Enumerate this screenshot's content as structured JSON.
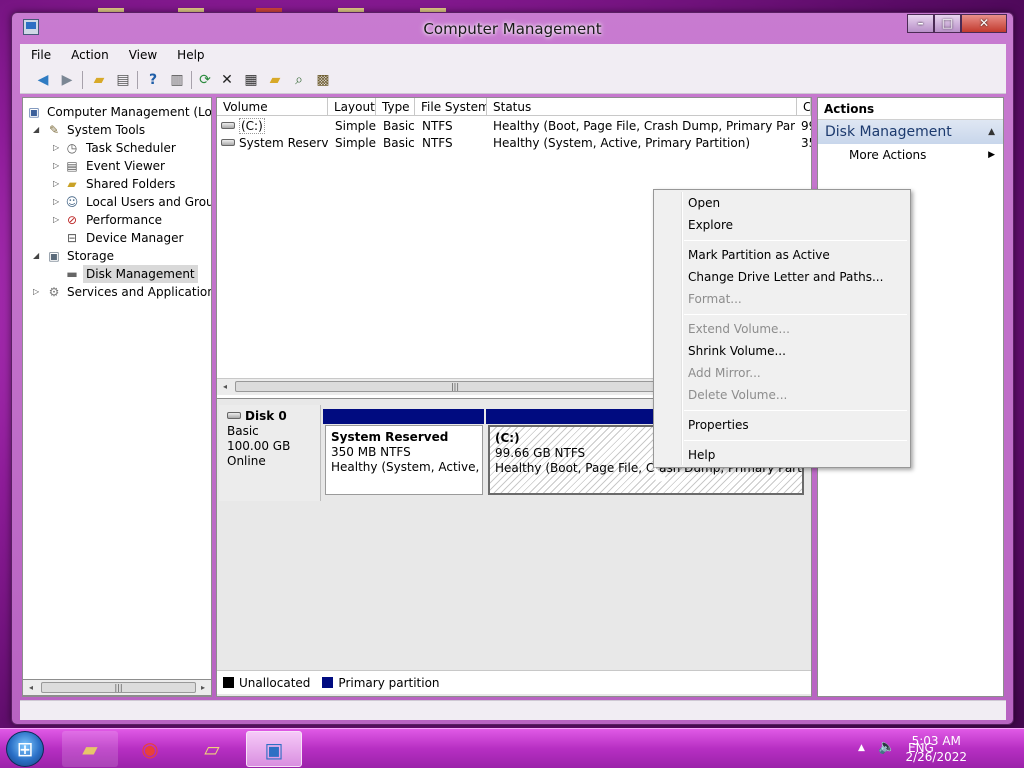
{
  "window": {
    "title": "Computer Management"
  },
  "menu": [
    "File",
    "Action",
    "View",
    "Help"
  ],
  "toolbar_icons": [
    "back-icon",
    "forward-icon",
    "up-folder-icon",
    "show-hide-tree-icon",
    "help-icon",
    "show-hide-action-pane-icon",
    "refresh-icon",
    "delete-icon",
    "properties-icon",
    "open-folder-icon",
    "search-icon",
    "connect-icon"
  ],
  "tree": [
    {
      "label": "Computer Management (Local",
      "depth": 0,
      "expander": "",
      "icon": "computer-icon"
    },
    {
      "label": "System Tools",
      "depth": 1,
      "expander": "open",
      "icon": "tools-icon"
    },
    {
      "label": "Task Scheduler",
      "depth": 2,
      "expander": "closed",
      "icon": "clock-icon"
    },
    {
      "label": "Event Viewer",
      "depth": 2,
      "expander": "closed",
      "icon": "event-viewer-icon"
    },
    {
      "label": "Shared Folders",
      "depth": 2,
      "expander": "closed",
      "icon": "shared-folder-icon"
    },
    {
      "label": "Local Users and Groups",
      "depth": 2,
      "expander": "closed",
      "icon": "users-icon"
    },
    {
      "label": "Performance",
      "depth": 2,
      "expander": "closed",
      "icon": "performance-icon"
    },
    {
      "label": "Device Manager",
      "depth": 2,
      "expander": "",
      "icon": "device-manager-icon"
    },
    {
      "label": "Storage",
      "depth": 1,
      "expander": "open",
      "icon": "storage-icon"
    },
    {
      "label": "Disk Management",
      "depth": 2,
      "expander": "",
      "icon": "disk-icon",
      "selected": true
    },
    {
      "label": "Services and Applications",
      "depth": 1,
      "expander": "closed",
      "icon": "services-icon"
    }
  ],
  "volume_columns": [
    "Volume",
    "Layout",
    "Type",
    "File System",
    "Status",
    "C"
  ],
  "volumes": [
    {
      "volume": "(C:)",
      "layout": "Simple",
      "type": "Basic",
      "fs": "NTFS",
      "status": "Healthy (Boot, Page File, Crash Dump, Primary Partition)",
      "cap": "99"
    },
    {
      "volume": "System Reserved",
      "layout": "Simple",
      "type": "Basic",
      "fs": "NTFS",
      "status": "Healthy (System, Active, Primary Partition)",
      "cap": "35"
    }
  ],
  "disk": {
    "name": "Disk 0",
    "type": "Basic",
    "size": "100.00 GB",
    "state": "Online",
    "partitions": [
      {
        "name": "System Reserved",
        "size": "350 MB NTFS",
        "status": "Healthy (System, Active, Primary Partition)"
      },
      {
        "name": "(C:)",
        "size": "99.66 GB NTFS",
        "status": "Healthy (Boot, Page File, Crash Dump, Primary Partition)"
      }
    ]
  },
  "legend": [
    {
      "label": "Unallocated",
      "color": "#000000"
    },
    {
      "label": "Primary partition",
      "color": "#000b80"
    }
  ],
  "actions": {
    "header": "Actions",
    "section": "Disk Management",
    "items": [
      "More Actions"
    ]
  },
  "context_menu": {
    "groups": [
      [
        {
          "label": "Open",
          "enabled": true
        },
        {
          "label": "Explore",
          "enabled": true
        }
      ],
      [
        {
          "label": "Mark Partition as Active",
          "enabled": true
        },
        {
          "label": "Change Drive Letter and Paths...",
          "enabled": true
        },
        {
          "label": "Format...",
          "enabled": false
        }
      ],
      [
        {
          "label": "Extend Volume...",
          "enabled": false
        },
        {
          "label": "Shrink Volume...",
          "enabled": true
        },
        {
          "label": "Add Mirror...",
          "enabled": false
        },
        {
          "label": "Delete Volume...",
          "enabled": false
        }
      ],
      [
        {
          "label": "Properties",
          "enabled": true
        }
      ],
      [
        {
          "label": "Help",
          "enabled": true
        }
      ]
    ]
  },
  "taskbar": {
    "apps": [
      "explorer-icon",
      "chrome-icon",
      "folder-icon",
      "computer-management-icon"
    ],
    "language": "ENG",
    "time": "5:03 AM",
    "date": "2/26/2022"
  },
  "colors": {
    "primary_partition": "#000b80",
    "selection": "#d9d9d9",
    "disabled_text": "#8d8d8d"
  }
}
